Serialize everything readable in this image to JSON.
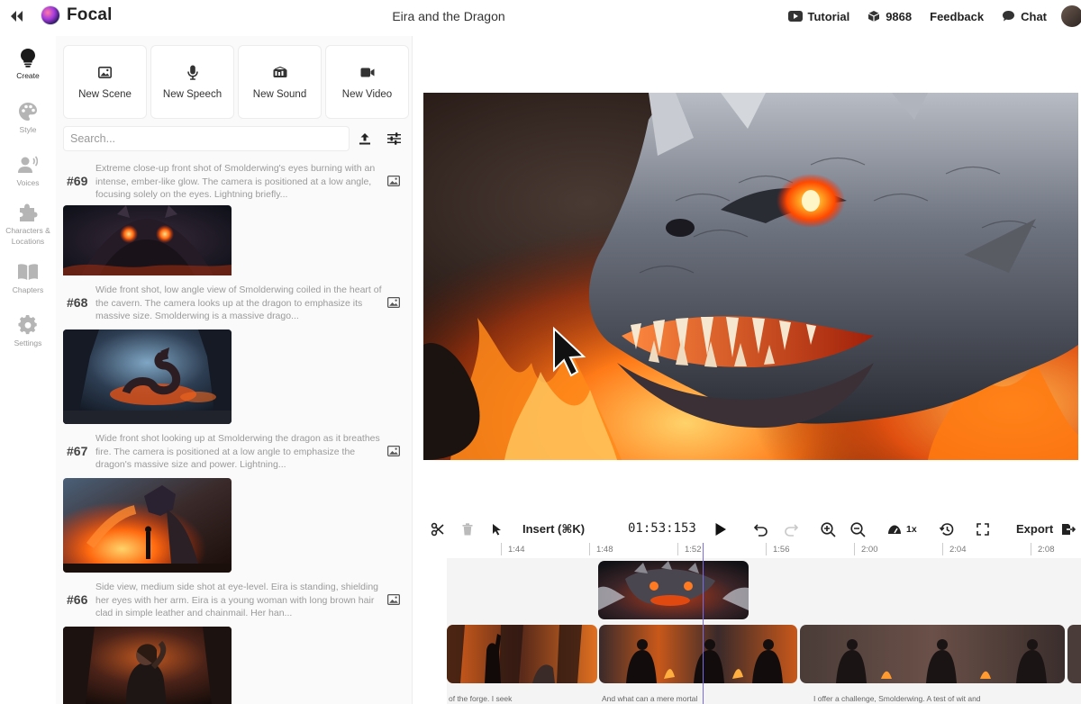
{
  "app": {
    "name": "Focal",
    "project_title": "Eira and the Dragon"
  },
  "header": {
    "tutorial_label": "Tutorial",
    "credits_value": "9868",
    "feedback_label": "Feedback",
    "chat_label": "Chat"
  },
  "rail": {
    "items": [
      {
        "label": "Create",
        "icon": "lightbulb-icon"
      },
      {
        "label": "Style",
        "icon": "palette-icon"
      },
      {
        "label": "Voices",
        "icon": "voice-user-icon"
      },
      {
        "label_line1": "Characters &",
        "label_line2": "Locations",
        "icon": "puzzle-icon"
      },
      {
        "label": "Chapters",
        "icon": "book-icon"
      },
      {
        "label": "Settings",
        "icon": "gear-icon"
      }
    ]
  },
  "create_panel": {
    "buttons": [
      {
        "label": "New Scene",
        "icon": "image-icon"
      },
      {
        "label": "New Speech",
        "icon": "microphone-icon"
      },
      {
        "label": "New Sound",
        "icon": "sound-icon"
      },
      {
        "label": "New Video",
        "icon": "video-camera-icon"
      }
    ],
    "search_placeholder": "Search...",
    "scenes": [
      {
        "number": "#69",
        "description": "Extreme close-up front shot of Smolderwing's eyes burning with an intense, ember-like glow. The camera is positioned at a low angle, focusing solely on the eyes. Lightning briefly..."
      },
      {
        "number": "#68",
        "description": "Wide front shot, low angle view of Smolderwing coiled in the heart of the cavern. The camera looks up at the dragon to emphasize its massive size. Smolderwing is a massive drago..."
      },
      {
        "number": "#67",
        "description": "Wide front shot looking up at Smolderwing the dragon as it breathes fire. The camera is positioned at a low angle to emphasize the dragon's massive size and power. Lightning..."
      },
      {
        "number": "#66",
        "description": "Side view, medium side shot at eye-level. Eira is standing, shielding her eyes with her arm. Eira is a young woman with long brown hair clad in simple leather and chainmail. Her han..."
      }
    ]
  },
  "timeline": {
    "insert_label": "Insert (⌘K)",
    "timecode": "01:53:153",
    "speed_label": "1x",
    "export_label": "Export",
    "ruler_ticks": [
      "1:44",
      "1:48",
      "1:52",
      "1:56",
      "2:00",
      "2:04",
      "2:08"
    ],
    "subtitles": [
      "of the forge. I seek",
      "And what can a mere mortal",
      "I offer a challenge, Smolderwing. A test of wit and"
    ]
  }
}
